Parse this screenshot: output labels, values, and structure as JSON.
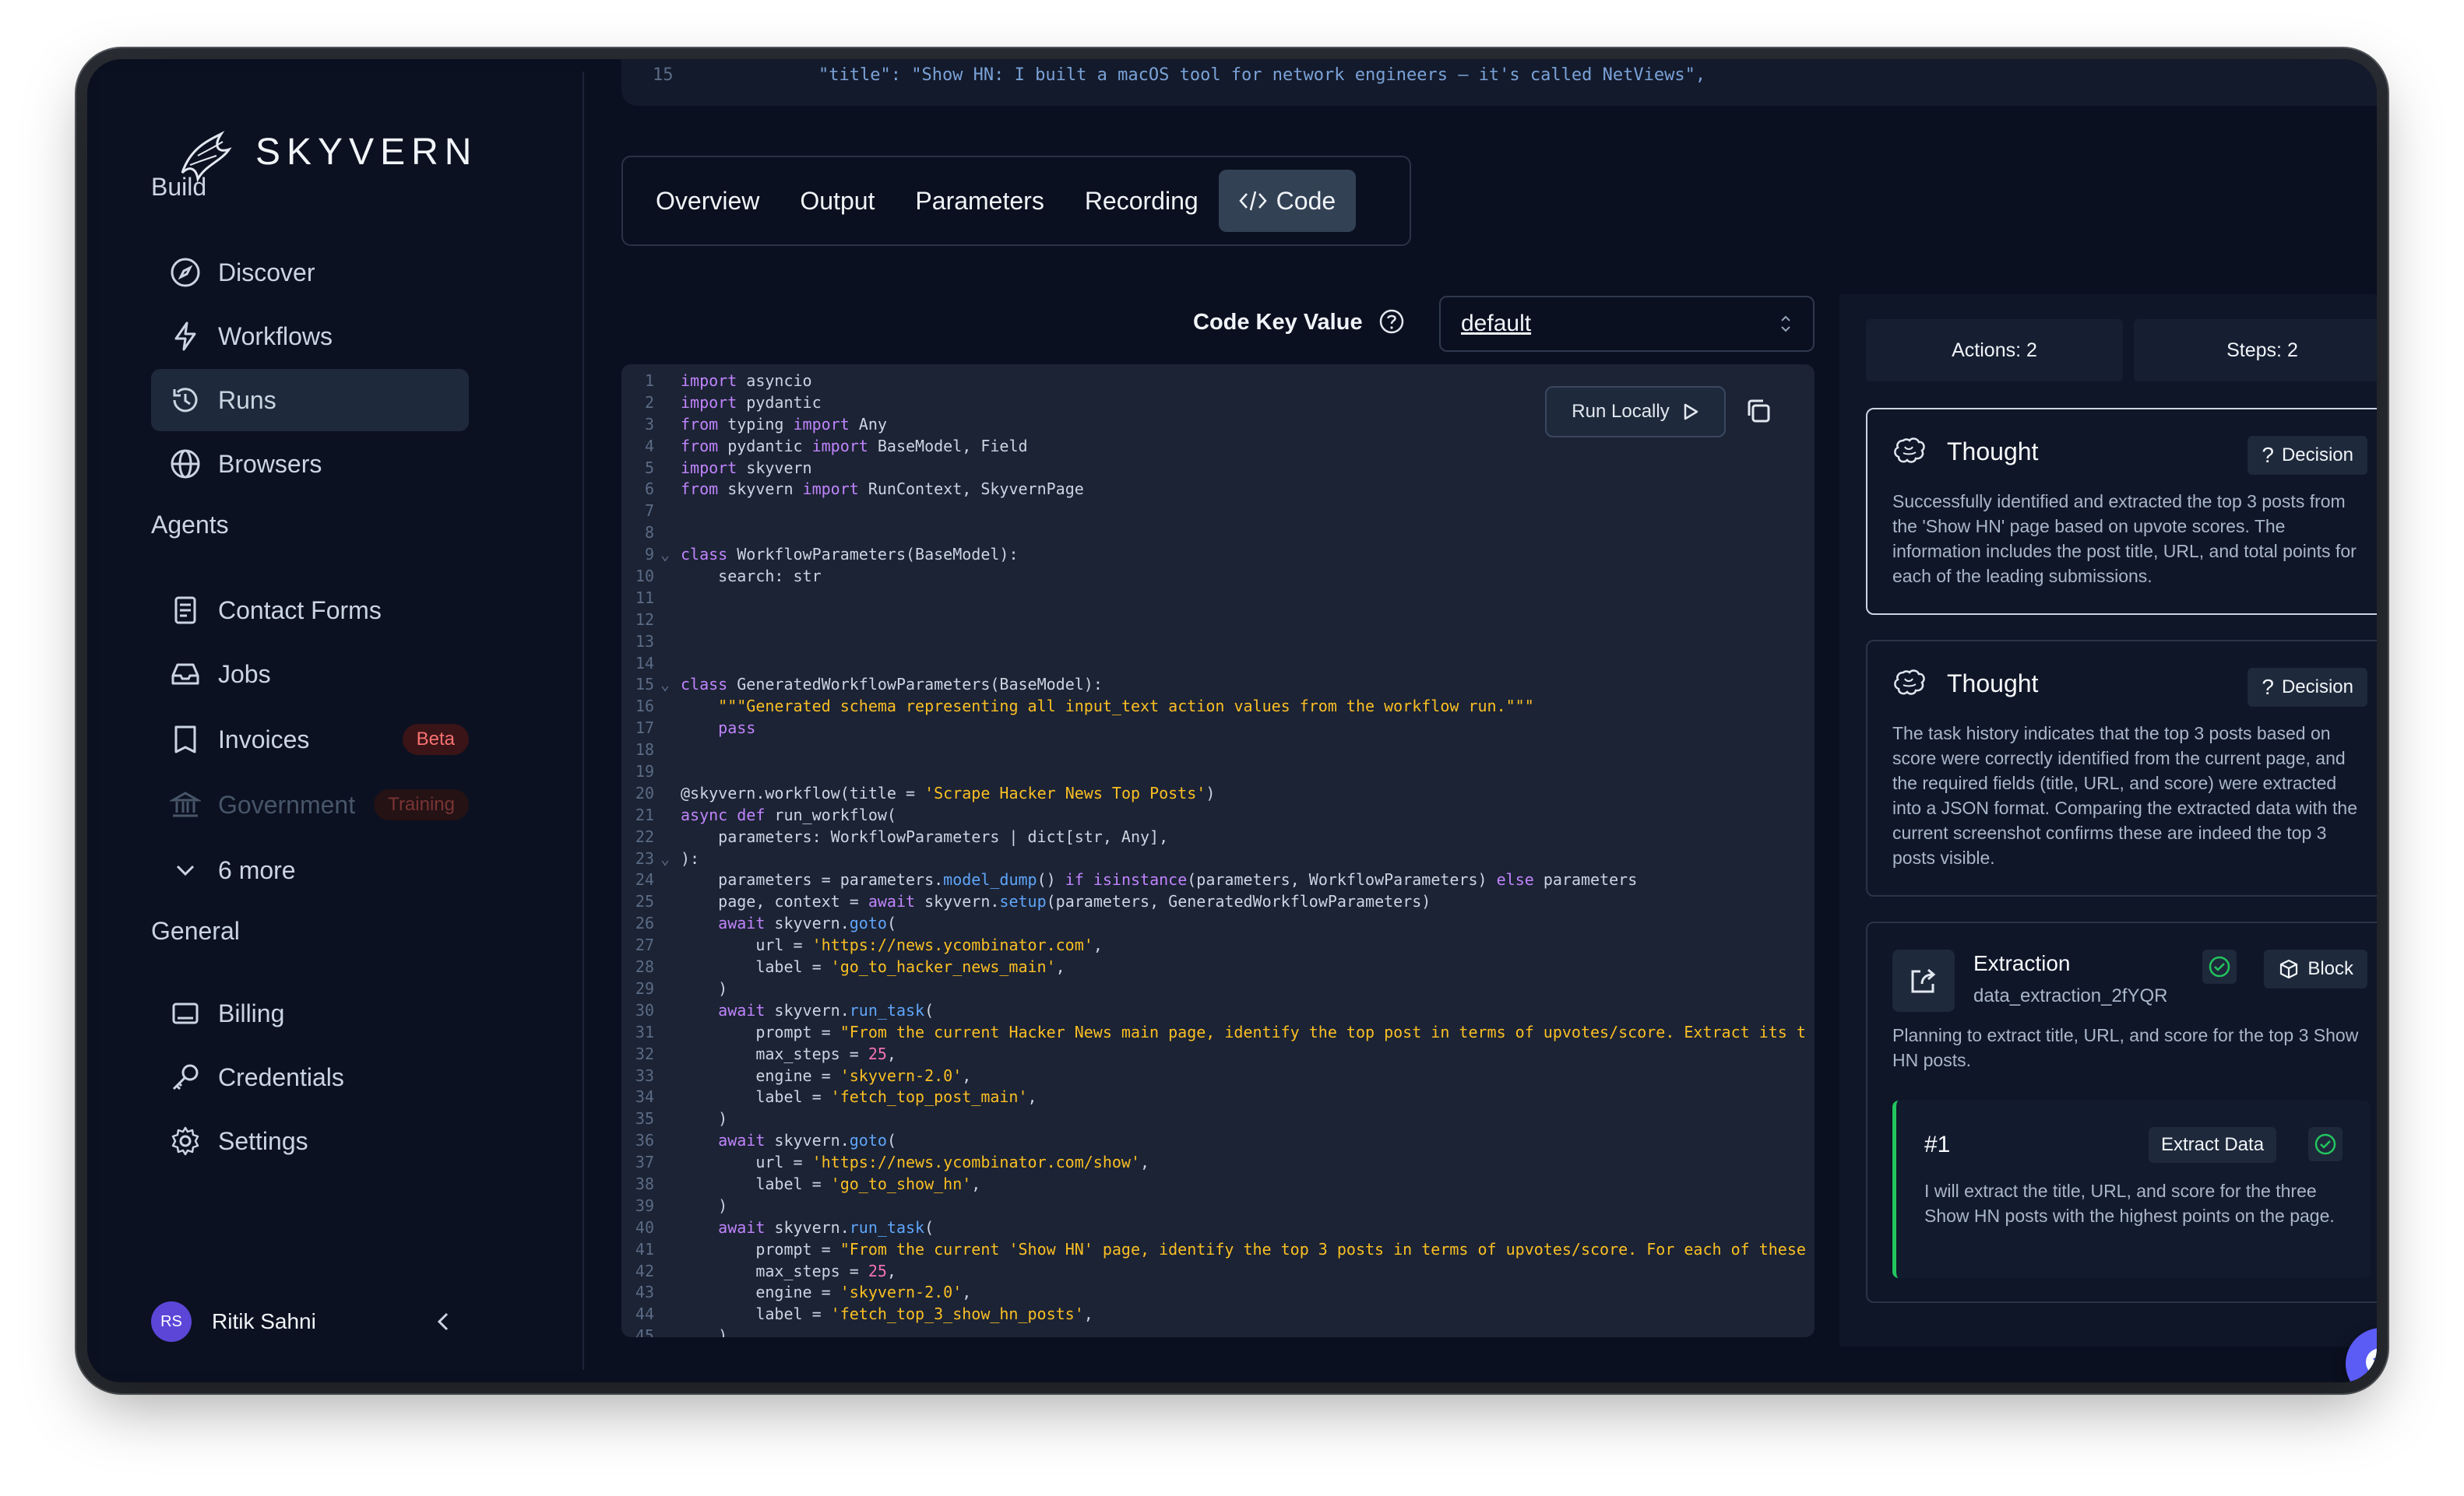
{
  "app": {
    "logo_text": "SKYVERN"
  },
  "sidebar": {
    "build_title": "Build",
    "build_items": [
      {
        "label": "Discover",
        "icon": "compass-icon"
      },
      {
        "label": "Workflows",
        "icon": "bolt-icon"
      },
      {
        "label": "Runs",
        "icon": "history-icon",
        "active": true
      },
      {
        "label": "Browsers",
        "icon": "globe-icon"
      }
    ],
    "agents_title": "Agents",
    "agent_items": [
      {
        "label": "Contact Forms",
        "icon": "form-icon"
      },
      {
        "label": "Jobs",
        "icon": "inbox-icon"
      },
      {
        "label": "Invoices",
        "icon": "book-icon",
        "badge": "Beta"
      },
      {
        "label": "Government",
        "icon": "bank-icon",
        "badge": "Training"
      }
    ],
    "more_label": "6 more",
    "general_title": "General",
    "general_items": [
      {
        "label": "Billing",
        "icon": "billing-icon"
      },
      {
        "label": "Credentials",
        "icon": "key-icon"
      },
      {
        "label": "Settings",
        "icon": "gear-icon"
      }
    ],
    "user": {
      "initials": "RS",
      "name": "Ritik Sahni"
    }
  },
  "top_strip": {
    "line_number": "15",
    "text": "\"title\": \"Show HN: I built a macOS tool for network engineers – it's called NetViews\","
  },
  "tabs": [
    {
      "label": "Overview"
    },
    {
      "label": "Output"
    },
    {
      "label": "Parameters"
    },
    {
      "label": "Recording"
    },
    {
      "label": "Code",
      "active": true
    }
  ],
  "code_key": {
    "label": "Code Key Value",
    "selected": "default"
  },
  "run_locally_label": "Run Locally",
  "right_panel": {
    "actions_label": "Actions: 2",
    "steps_label": "Steps: 2",
    "thought1": {
      "title": "Thought",
      "pill": "Decision",
      "body": "Successfully identified and extracted the top 3 posts from the 'Show HN' page based on upvote scores. The information includes the post title, URL, and total points for each of the leading submissions."
    },
    "thought2": {
      "title": "Thought",
      "pill": "Decision",
      "body": "The task history indicates that the top 3 posts based on score were correctly identified from the current page, and the required fields (title, URL, and score) were extracted into a JSON format. Comparing the extracted data with the current screenshot confirms these are indeed the top 3 posts visible."
    },
    "extraction": {
      "title": "Extraction",
      "subtitle": "data_extraction_2fYQR",
      "pill": "Block",
      "body": "Planning to extract title, URL, and score for the top 3 Show HN posts.",
      "action": {
        "number": "#1",
        "pill": "Extract Data",
        "body": "I will extract the title, URL, and score for the three Show HN posts with the highest points on the page."
      }
    }
  },
  "colors": {
    "accent": "#5b5bf6",
    "success": "#22c55e",
    "badge": "#f87171"
  }
}
